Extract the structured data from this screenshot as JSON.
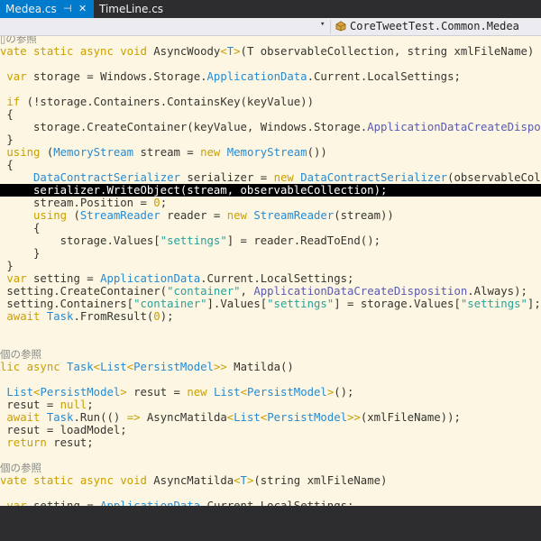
{
  "tabs": [
    {
      "label": "Medea.cs",
      "pin_icon": "⊣",
      "close_icon": "✕"
    },
    {
      "label": "TimeLine.cs"
    }
  ],
  "navbar": {
    "dropdown_icon": "▾",
    "member": "CoreTweetTest.Common.Medea"
  },
  "code_lines": [
    {
      "tokens": [
        {
          "t": "▯の参照",
          "c": "cm"
        }
      ]
    },
    {
      "tokens": [
        {
          "t": "vate static async void ",
          "c": "kw"
        },
        {
          "t": "AsyncWoody"
        },
        {
          "t": "<",
          "c": "kw"
        },
        {
          "t": "T",
          "c": "ty"
        },
        {
          "t": ">",
          "c": "kw"
        },
        {
          "t": "(T observableCollection, string xmlFileName)"
        }
      ]
    },
    {
      "tokens": []
    },
    {
      "tokens": [
        {
          "t": " var ",
          "c": "kw"
        },
        {
          "t": "storage = Windows.Storage."
        },
        {
          "t": "ApplicationData",
          "c": "ty"
        },
        {
          "t": ".Current.LocalSettings;"
        }
      ]
    },
    {
      "tokens": []
    },
    {
      "tokens": [
        {
          "t": " if ",
          "c": "kw"
        },
        {
          "t": "(!storage.Containers.ContainsKey(keyValue))"
        }
      ]
    },
    {
      "tokens": [
        {
          "t": " {"
        }
      ]
    },
    {
      "tokens": [
        {
          "t": "     storage.CreateContainer(keyValue, Windows.Storage."
        },
        {
          "t": "ApplicationDataCreateDisposition.Always);",
          "c": "tv"
        }
      ]
    },
    {
      "tokens": [
        {
          "t": " }"
        }
      ]
    },
    {
      "tokens": [
        {
          "t": " using ",
          "c": "kw"
        },
        {
          "t": "("
        },
        {
          "t": "MemoryStream ",
          "c": "ty"
        },
        {
          "t": "stream = "
        },
        {
          "t": "new ",
          "c": "kw"
        },
        {
          "t": "MemoryStream",
          "c": "ty"
        },
        {
          "t": "())"
        }
      ]
    },
    {
      "tokens": [
        {
          "t": " {"
        }
      ]
    },
    {
      "tokens": [
        {
          "t": "     "
        },
        {
          "t": "DataContractSerializer ",
          "c": "ty"
        },
        {
          "t": "serializer = "
        },
        {
          "t": "new ",
          "c": "kw"
        },
        {
          "t": "DataContractSerializer",
          "c": "ty"
        },
        {
          "t": "(observableCollection.GetType());"
        }
      ]
    },
    {
      "hl": true,
      "tokens": [
        {
          "t": "     serializer.WriteObject(stream, observableCollection);"
        }
      ]
    },
    {
      "tokens": [
        {
          "t": "     stream.Position = "
        },
        {
          "t": "0",
          "c": "lit"
        },
        {
          "t": ";"
        }
      ]
    },
    {
      "tokens": [
        {
          "t": "     using ",
          "c": "kw"
        },
        {
          "t": "("
        },
        {
          "t": "StreamReader ",
          "c": "ty"
        },
        {
          "t": "reader = "
        },
        {
          "t": "new ",
          "c": "kw"
        },
        {
          "t": "StreamReader",
          "c": "ty"
        },
        {
          "t": "(stream))"
        }
      ]
    },
    {
      "tokens": [
        {
          "t": "     {"
        }
      ]
    },
    {
      "tokens": [
        {
          "t": "         storage.Values["
        },
        {
          "t": "\"settings\"",
          "c": "str"
        },
        {
          "t": "] = reader.ReadToEnd();"
        }
      ]
    },
    {
      "tokens": [
        {
          "t": "     }"
        }
      ]
    },
    {
      "tokens": [
        {
          "t": " }"
        }
      ]
    },
    {
      "tokens": [
        {
          "t": " var ",
          "c": "kw"
        },
        {
          "t": "setting = "
        },
        {
          "t": "ApplicationData",
          "c": "ty"
        },
        {
          "t": ".Current.LocalSettings;"
        }
      ]
    },
    {
      "tokens": [
        {
          "t": " setting.CreateContainer("
        },
        {
          "t": "\"container\"",
          "c": "str"
        },
        {
          "t": ", "
        },
        {
          "t": "ApplicationDataCreateDisposition",
          "c": "tv"
        },
        {
          "t": ".Always);"
        }
      ]
    },
    {
      "tokens": [
        {
          "t": " setting.Containers["
        },
        {
          "t": "\"container\"",
          "c": "str"
        },
        {
          "t": "].Values["
        },
        {
          "t": "\"settings\"",
          "c": "str"
        },
        {
          "t": "] = storage.Values["
        },
        {
          "t": "\"settings\"",
          "c": "str"
        },
        {
          "t": "];"
        }
      ]
    },
    {
      "tokens": [
        {
          "t": " await ",
          "c": "kw"
        },
        {
          "t": "Task",
          "c": "ty"
        },
        {
          "t": ".FromResult("
        },
        {
          "t": "0",
          "c": "lit"
        },
        {
          "t": ");"
        }
      ]
    },
    {
      "tokens": []
    },
    {
      "tokens": []
    },
    {
      "tokens": [
        {
          "t": "個の参照",
          "c": "cm"
        }
      ]
    },
    {
      "tokens": [
        {
          "t": "lic async ",
          "c": "kw"
        },
        {
          "t": "Task",
          "c": "ty"
        },
        {
          "t": "<",
          "c": "kw"
        },
        {
          "t": "List",
          "c": "ty"
        },
        {
          "t": "<",
          "c": "kw"
        },
        {
          "t": "PersistModel",
          "c": "ty"
        },
        {
          "t": ">> ",
          "c": "kw"
        },
        {
          "t": "Matilda()"
        }
      ]
    },
    {
      "tokens": []
    },
    {
      "tokens": [
        {
          "t": " "
        },
        {
          "t": "List",
          "c": "ty"
        },
        {
          "t": "<",
          "c": "kw"
        },
        {
          "t": "PersistModel",
          "c": "ty"
        },
        {
          "t": "> ",
          "c": "kw"
        },
        {
          "t": "resut = "
        },
        {
          "t": "new ",
          "c": "kw"
        },
        {
          "t": "List",
          "c": "ty"
        },
        {
          "t": "<",
          "c": "kw"
        },
        {
          "t": "PersistModel",
          "c": "ty"
        },
        {
          "t": ">",
          "c": "kw"
        },
        {
          "t": "();"
        }
      ]
    },
    {
      "tokens": [
        {
          "t": " resut = "
        },
        {
          "t": "null",
          "c": "kw"
        },
        {
          "t": ";"
        }
      ]
    },
    {
      "tokens": [
        {
          "t": " await ",
          "c": "kw"
        },
        {
          "t": "Task",
          "c": "ty"
        },
        {
          "t": ".Run(() "
        },
        {
          "t": "=> ",
          "c": "kw"
        },
        {
          "t": "AsyncMatilda"
        },
        {
          "t": "<",
          "c": "kw"
        },
        {
          "t": "List",
          "c": "ty"
        },
        {
          "t": "<",
          "c": "kw"
        },
        {
          "t": "PersistModel",
          "c": "ty"
        },
        {
          "t": ">>",
          "c": "kw"
        },
        {
          "t": "(xmlFileName));"
        }
      ]
    },
    {
      "tokens": [
        {
          "t": " resut = loadModel;"
        }
      ]
    },
    {
      "tokens": [
        {
          "t": " return ",
          "c": "kw"
        },
        {
          "t": "resut;"
        }
      ]
    },
    {
      "tokens": []
    },
    {
      "tokens": [
        {
          "t": "個の参照",
          "c": "cm"
        }
      ]
    },
    {
      "tokens": [
        {
          "t": "vate static async void ",
          "c": "kw"
        },
        {
          "t": "AsyncMatilda"
        },
        {
          "t": "<",
          "c": "kw"
        },
        {
          "t": "T",
          "c": "ty"
        },
        {
          "t": ">",
          "c": "kw"
        },
        {
          "t": "(string xmlFileName)"
        }
      ]
    },
    {
      "tokens": []
    },
    {
      "tokens": [
        {
          "t": " var ",
          "c": "kw"
        },
        {
          "t": "setting = "
        },
        {
          "t": "ApplicationData",
          "c": "ty"
        },
        {
          "t": ".Current.LocalSettings;"
        }
      ]
    }
  ]
}
